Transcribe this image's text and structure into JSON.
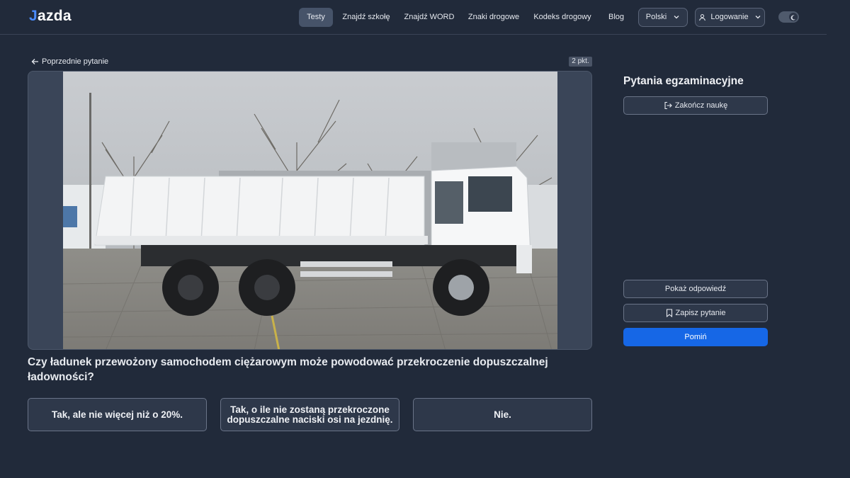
{
  "nav": {
    "logo": "Jazda",
    "items": [
      {
        "label": "Testy",
        "active": true
      },
      {
        "label": "Znajdź szkołę",
        "active": false
      },
      {
        "label": "Znajdź WORD",
        "active": false
      },
      {
        "label": "Znaki drogowe",
        "active": false
      },
      {
        "label": "Kodeks drogowy",
        "active": false
      },
      {
        "label": "Blog",
        "active": false
      }
    ],
    "language": "Polski",
    "login": "Logowanie",
    "theme_toggle_icon": "moon-icon"
  },
  "question_panel": {
    "back_label": "Poprzednie pytanie",
    "points": "2 pkt.",
    "question": "Czy ładunek przewożony samochodem ciężarowym może powodować przekroczenie dopuszczalnej ładowności?",
    "answers": [
      "Tak, ale nie więcej niż o 20%.",
      "Tak, o ile nie zostaną przekroczone dopuszczalne naciski osi na jezdnię.",
      "Nie."
    ]
  },
  "sidebar": {
    "title": "Pytania egzaminacyjne",
    "end_label": "Zakończ naukę",
    "show_answer_label": "Pokaż odpowiedź",
    "save_label": "Zapisz pytanie",
    "skip_label": "Pomiń"
  },
  "colors": {
    "background": "#212a3a",
    "accent": "#1667e6",
    "panel": "#3a4558"
  }
}
